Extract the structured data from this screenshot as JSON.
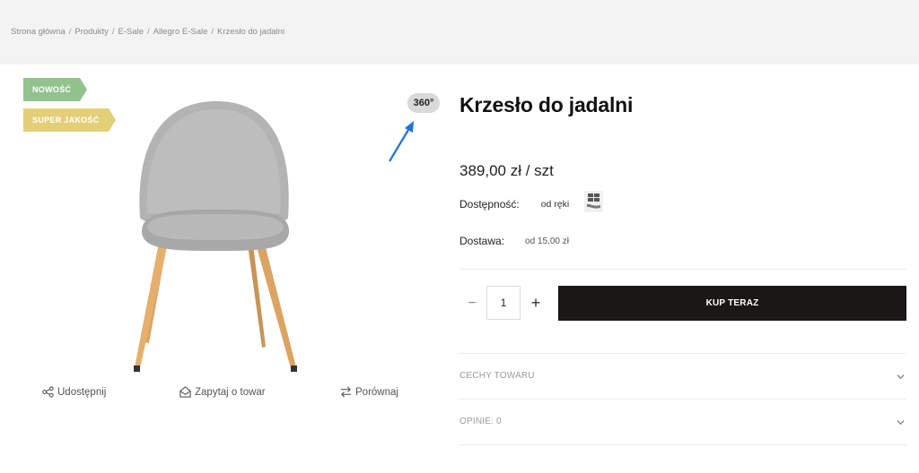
{
  "breadcrumb": [
    "Strona główna",
    "Produkty",
    "E-Sale",
    "Allegro E-Sale",
    "Krzesło do jadalni"
  ],
  "breadcrumb_separator": "/",
  "badges": {
    "new": "NOWOŚĆ",
    "quality": "SUPER JAKOŚĆ",
    "view360": "360°"
  },
  "colors": {
    "badge_new": "#93c28f",
    "badge_quality": "#e3cf78",
    "buy_button": "#1b1716",
    "arrow": "#1e73d8",
    "topbar": "#f3f3f3"
  },
  "actions": {
    "share": "Udostępnij",
    "ask": "Zapytaj o towar",
    "compare": "Porównaj"
  },
  "product": {
    "title": "Krzesło do jadalni",
    "price": "389,00 zł / szt",
    "availability_label": "Dostępność:",
    "availability_value": "od ręki",
    "shipping_label": "Dostawa:",
    "shipping_value": "od 15,00 zł"
  },
  "cart": {
    "minus": "−",
    "quantity": "1",
    "plus": "+",
    "buy_label": "KUP TERAZ"
  },
  "accordion": [
    {
      "label": "CECHY TOWARU"
    },
    {
      "label": "OPINIE: 0"
    }
  ],
  "icons": {
    "share": "share-icon",
    "ask": "envelope-icon",
    "compare": "compare-arrows-icon",
    "stock": "stock-icon",
    "chevron": "chevron-down-icon"
  }
}
